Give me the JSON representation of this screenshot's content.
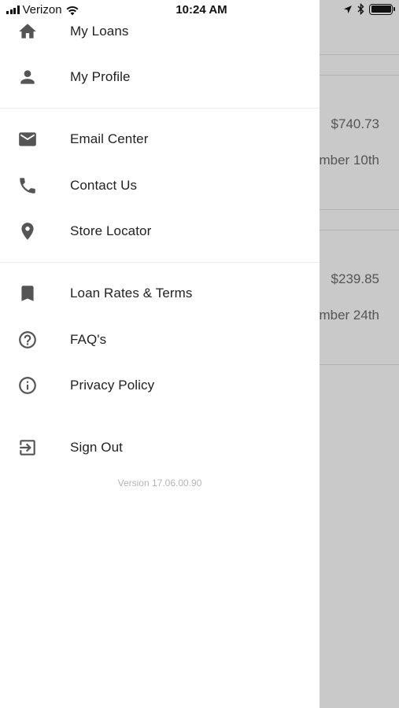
{
  "status_bar": {
    "carrier": "Verizon",
    "time": "10:24 AM"
  },
  "background": {
    "row1_amount": "$740.73",
    "row1_date": "mber 10th",
    "row2_amount": "$239.85",
    "row2_date": "mber 24th"
  },
  "menu": {
    "items": [
      {
        "label": "My Loans",
        "icon": "home-icon"
      },
      {
        "label": "My Profile",
        "icon": "person-icon"
      },
      {
        "label": "Email Center",
        "icon": "envelope-icon"
      },
      {
        "label": "Contact Us",
        "icon": "phone-icon"
      },
      {
        "label": "Store Locator",
        "icon": "location-pin-icon"
      },
      {
        "label": "Loan Rates & Terms",
        "icon": "bookmark-icon"
      },
      {
        "label": "FAQ's",
        "icon": "question-circle-icon"
      },
      {
        "label": "Privacy Policy",
        "icon": "info-circle-icon"
      },
      {
        "label": "Sign Out",
        "icon": "sign-out-icon"
      }
    ],
    "version": "Version 17.06.00.90"
  }
}
